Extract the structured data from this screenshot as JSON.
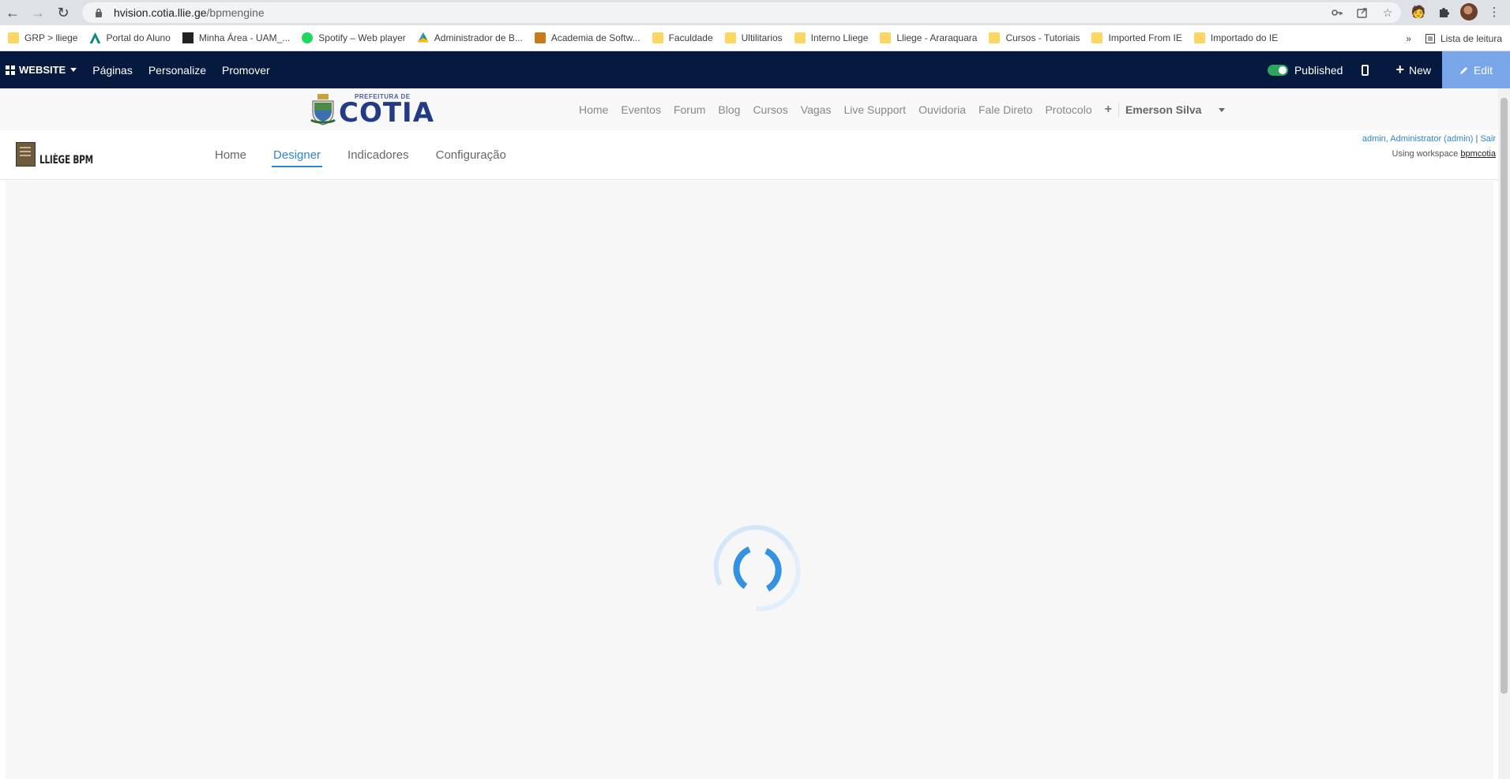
{
  "browser": {
    "url_host": "hvision.cotia.llie.ge",
    "url_path": "/bpmengine",
    "bookmarks": [
      {
        "label": "GRP > lliege",
        "icon": "folder-icon"
      },
      {
        "label": "Portal do Aluno",
        "icon": "anima-icon"
      },
      {
        "label": "Minha Área - UAM_...",
        "icon": "blackboard-icon"
      },
      {
        "label": "Spotify – Web player",
        "icon": "spotify-icon"
      },
      {
        "label": "Administrador de B...",
        "icon": "drive-icon"
      },
      {
        "label": "Academia de Softw...",
        "icon": "academia-icon"
      },
      {
        "label": "Faculdade",
        "icon": "folder-icon"
      },
      {
        "label": "Ultilitarios",
        "icon": "folder-icon"
      },
      {
        "label": "Interno Lliege",
        "icon": "folder-icon"
      },
      {
        "label": "Lliege - Araraquara",
        "icon": "folder-icon"
      },
      {
        "label": "Cursos - Tutoriais",
        "icon": "folder-icon"
      },
      {
        "label": "Imported From IE",
        "icon": "folder-icon"
      },
      {
        "label": "Importado do IE",
        "icon": "folder-icon"
      }
    ],
    "more_bookmarks": "»",
    "reading_list": "Lista de leitura"
  },
  "odoo_bar": {
    "apps_label": "WEBSITE",
    "menus": [
      "Páginas",
      "Personalize",
      "Promover"
    ],
    "published_label": "Published",
    "new_label": "New",
    "edit_label": "Edit"
  },
  "site_header": {
    "logo_small": "PREFEITURA DE",
    "logo_big": "COTIA",
    "nav": [
      "Home",
      "Eventos",
      "Forum",
      "Blog",
      "Cursos",
      "Vagas",
      "Live Support",
      "Ouvidoria",
      "Fale Direto",
      "Protocolo"
    ],
    "plus": "+",
    "user": "Emerson Silva"
  },
  "bpm_header": {
    "logo_text": "LLIÈGE BPM",
    "tabs": [
      "Home",
      "Designer",
      "Indicadores",
      "Configuração"
    ],
    "active_tab": "Designer",
    "user_line": "admin, Administrator (admin)",
    "separator": "|",
    "logout": "Sair",
    "workspace_prefix": "Using workspace",
    "workspace": "bpmcotia"
  },
  "colors": {
    "odoo_bar": "#051a3e",
    "edit_button": "#78a6e8",
    "accent": "#2b86d6",
    "published_toggle": "#2ea55f",
    "spinner": "#3592e0"
  }
}
